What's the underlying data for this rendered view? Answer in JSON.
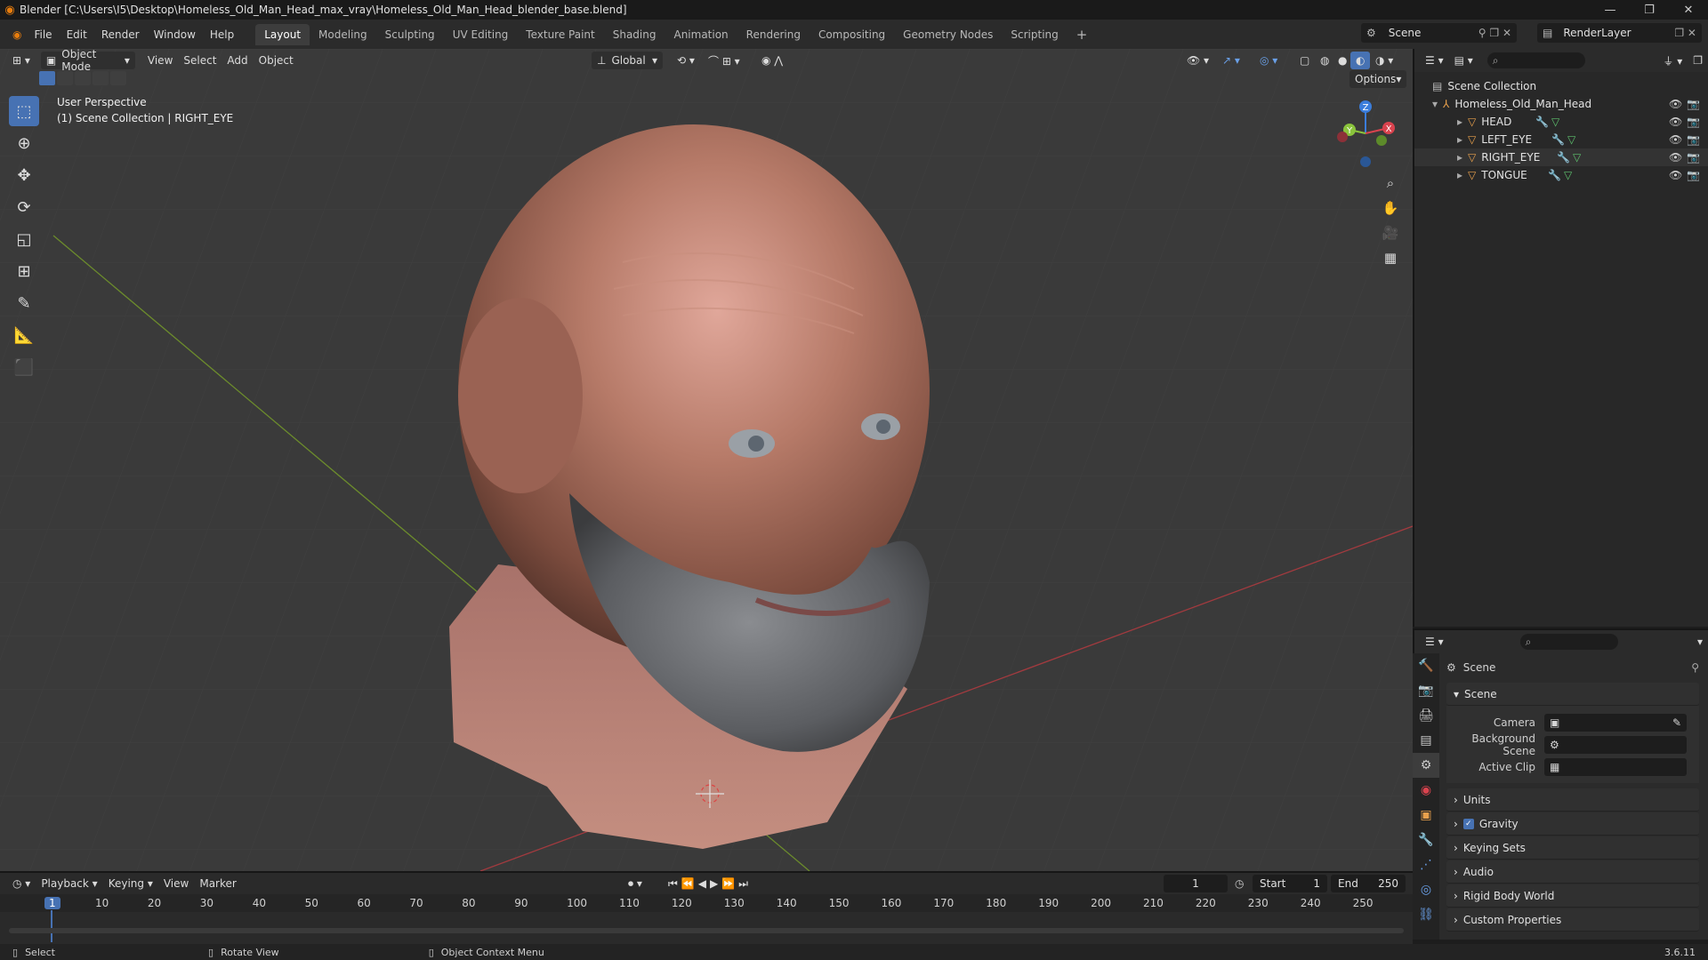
{
  "window": {
    "title": "Blender [C:\\Users\\I5\\Desktop\\Homeless_Old_Man_Head_max_vray\\Homeless_Old_Man_Head_blender_base.blend]"
  },
  "menus": [
    "File",
    "Edit",
    "Render",
    "Window",
    "Help"
  ],
  "workspaces": [
    "Layout",
    "Modeling",
    "Sculpting",
    "UV Editing",
    "Texture Paint",
    "Shading",
    "Animation",
    "Rendering",
    "Compositing",
    "Geometry Nodes",
    "Scripting"
  ],
  "active_workspace": "Layout",
  "scene_selector": "Scene",
  "view_layer": "RenderLayer",
  "viewport": {
    "mode": "Object Mode",
    "menus": [
      "View",
      "Select",
      "Add",
      "Object"
    ],
    "transform_orientation": "Global",
    "options_label": "Options",
    "overlay_title": "User Perspective",
    "overlay_subtitle": "(1) Scene Collection | RIGHT_EYE",
    "gizmo": {
      "z": "Z",
      "y": "Y",
      "x": "X"
    }
  },
  "outliner": {
    "root": "Scene Collection",
    "collection": "Homeless_Old_Man_Head",
    "objects": [
      "HEAD",
      "LEFT_EYE",
      "RIGHT_EYE",
      "TONGUE"
    ]
  },
  "properties": {
    "context": "Scene",
    "panel_title": "Scene",
    "fields": [
      {
        "label": "Camera"
      },
      {
        "label": "Background Scene"
      },
      {
        "label": "Active Clip"
      }
    ],
    "sections": [
      "Units",
      "Gravity",
      "Keying Sets",
      "Audio",
      "Rigid Body World",
      "Custom Properties"
    ],
    "gravity_checked": true
  },
  "timeline": {
    "menus": [
      "Playback",
      "Keying",
      "View",
      "Marker"
    ],
    "current_frame": "1",
    "start_label": "Start",
    "start": "1",
    "end_label": "End",
    "end": "250",
    "ticks": [
      "1",
      "10",
      "20",
      "30",
      "40",
      "50",
      "60",
      "70",
      "80",
      "90",
      "100",
      "110",
      "120",
      "130",
      "140",
      "150",
      "160",
      "170",
      "180",
      "190",
      "200",
      "210",
      "220",
      "230",
      "240",
      "250"
    ]
  },
  "statusbar": {
    "select": "Select",
    "rotate": "Rotate View",
    "context_menu": "Object Context Menu",
    "version": "3.6.11"
  },
  "colors": {
    "accent": "#4772b3",
    "object_icon": "#e8a04c",
    "mesh_icon": "#5ec26e",
    "axis_x": "#d9434e",
    "axis_y": "#8ac33c",
    "axis_z": "#3b7ddb"
  }
}
